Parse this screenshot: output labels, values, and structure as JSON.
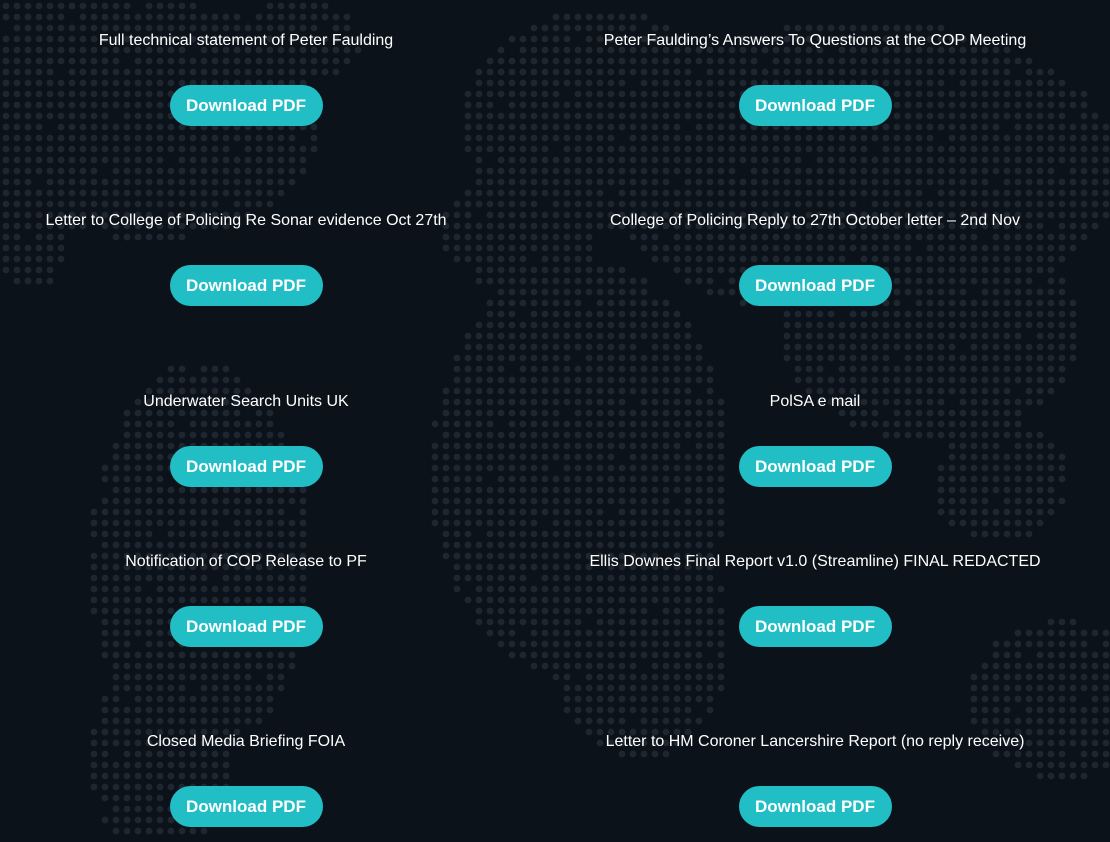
{
  "documents": [
    {
      "title": "Full technical statement of Peter Faulding",
      "button": "Download PDF"
    },
    {
      "title": "Peter Faulding’s Answers To Questions at the COP Meeting",
      "button": "Download PDF"
    },
    {
      "title": "Letter to College of Policing Re Sonar evidence Oct 27th",
      "button": "Download PDF"
    },
    {
      "title": "College of Policing Reply to 27th October letter – 2nd Nov",
      "button": "Download PDF"
    },
    {
      "title": "Underwater Search Units UK",
      "button": "Download PDF"
    },
    {
      "title": "PolSA e mail",
      "button": "Download PDF"
    },
    {
      "title": "Notification of COP Release to PF",
      "button": "Download PDF"
    },
    {
      "title": "Ellis Downes Final Report v1.0 (Streamline) FINAL REDACTED",
      "button": "Download PDF"
    },
    {
      "title": "Closed Media Briefing FOIA",
      "button": "Download PDF"
    },
    {
      "title": "Letter to HM Coroner Lancershire Report (no reply receive)",
      "button": "Download PDF"
    }
  ],
  "colors": {
    "background": "#0b121a",
    "button": "#22bec6",
    "text": "#ffffff",
    "map_dots": "#1e2630"
  }
}
